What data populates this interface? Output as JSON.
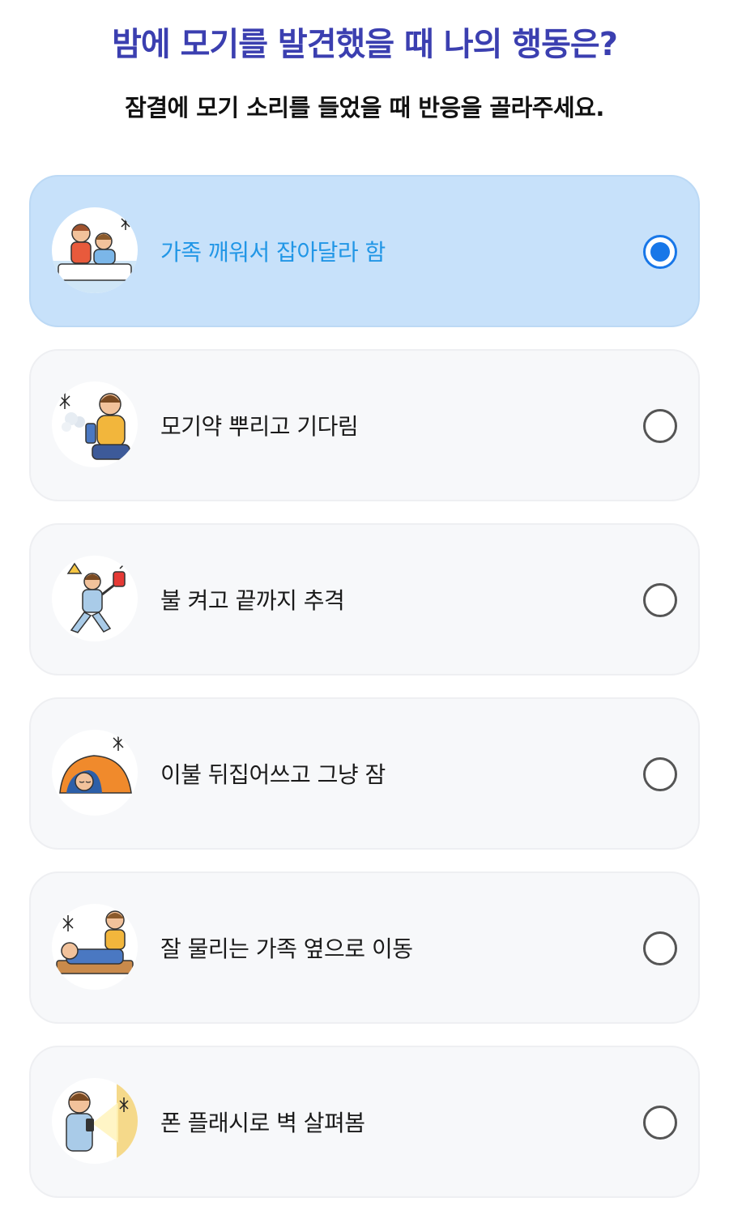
{
  "header": {
    "title": "밤에 모기를 발견했을 때 나의 행동은?",
    "subtitle": "잠결에 모기 소리를 들었을 때 반응을 골라주세요."
  },
  "colors": {
    "title": "#3b3fb0",
    "selected_bg": "#c7e1fa",
    "selected_text": "#2196e6",
    "radio_accent": "#1877e8",
    "card_bg": "#f7f8fa"
  },
  "options": [
    {
      "label": "가족 깨워서 잡아달라 함",
      "selected": true,
      "icon": "family-waking-mosquito-icon"
    },
    {
      "label": "모기약 뿌리고 기다림",
      "selected": false,
      "icon": "mosquito-spray-icon"
    },
    {
      "label": "불 켜고 끝까지 추격",
      "selected": false,
      "icon": "chasing-mosquito-icon"
    },
    {
      "label": "이불 뒤집어쓰고 그냥 잠",
      "selected": false,
      "icon": "blanket-sleep-icon"
    },
    {
      "label": "잘 물리는 가족 옆으로 이동",
      "selected": false,
      "icon": "move-beside-family-icon"
    },
    {
      "label": "폰 플래시로 벽 살펴봄",
      "selected": false,
      "icon": "phone-flashlight-icon"
    }
  ]
}
